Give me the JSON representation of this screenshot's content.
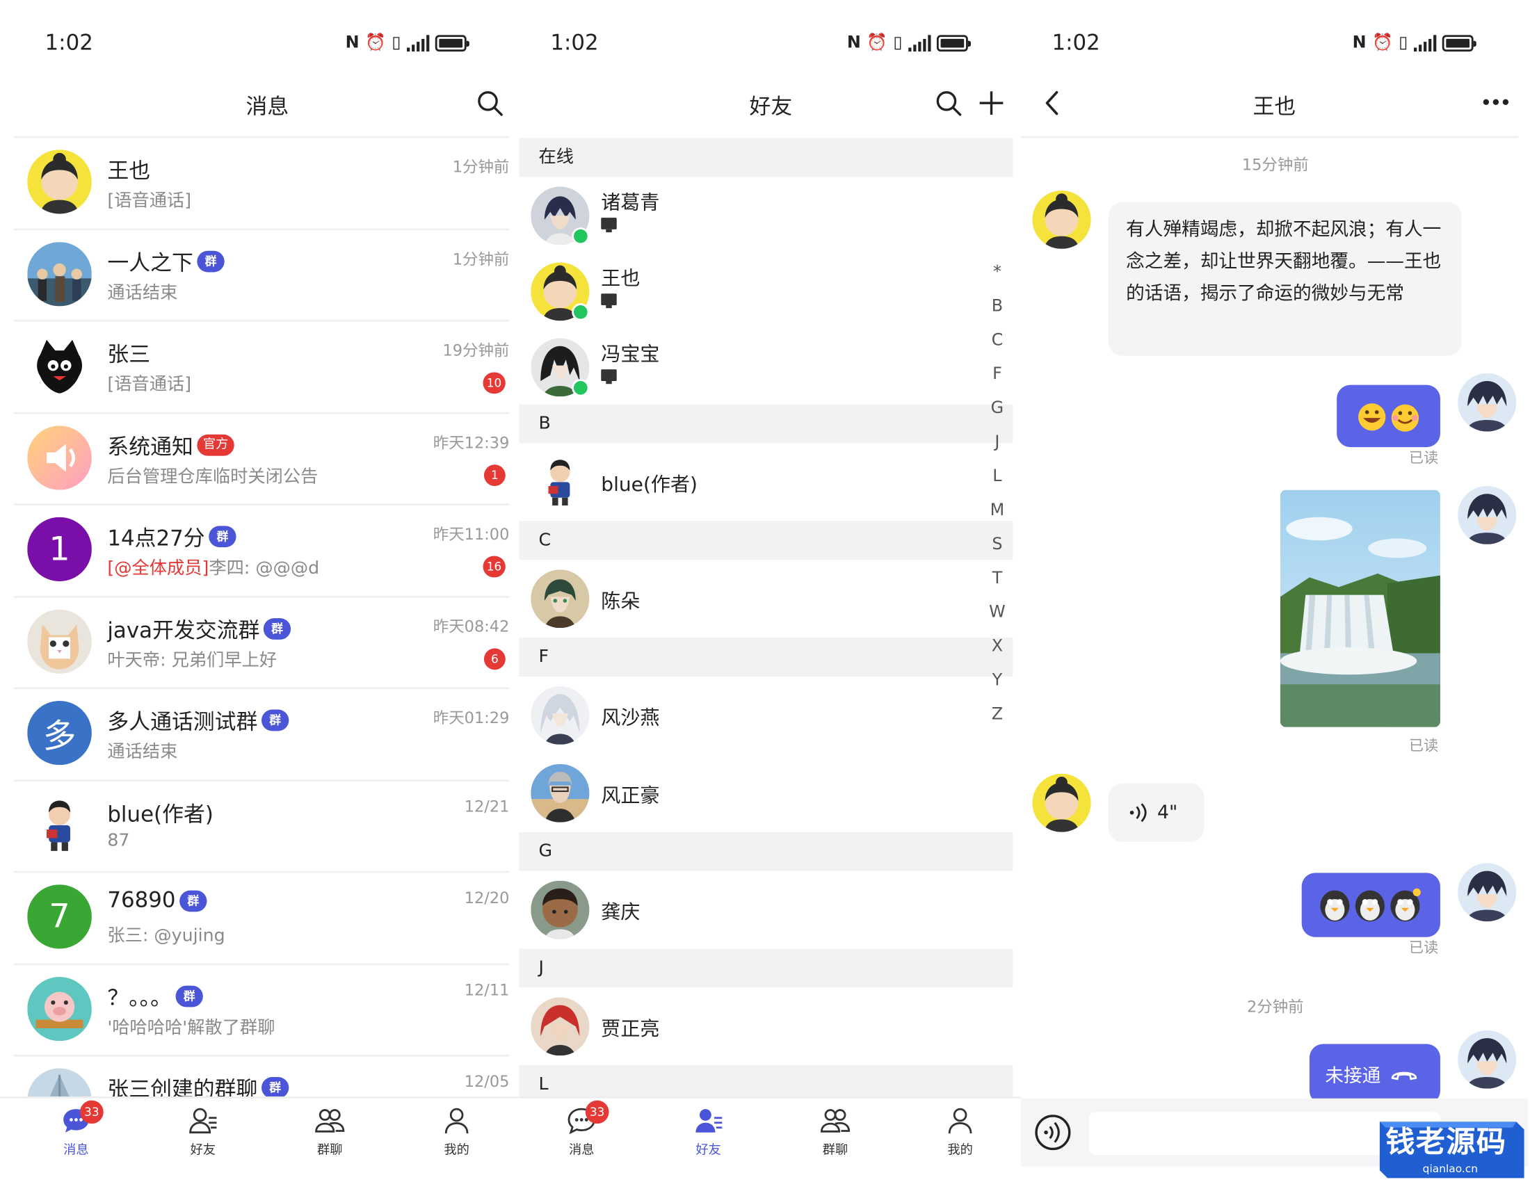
{
  "status": {
    "time": "1:02"
  },
  "messages_screen": {
    "title": "消息",
    "items": [
      {
        "name": "王也",
        "tag": "",
        "sub": "[语音通话]",
        "sub_prefix": "",
        "time": "1分钟前",
        "unread": ""
      },
      {
        "name": "一人之下",
        "tag": "群",
        "sub": "通话结束",
        "sub_prefix": "",
        "time": "1分钟前",
        "unread": ""
      },
      {
        "name": "张三",
        "tag": "",
        "sub": "[语音通话]",
        "sub_prefix": "",
        "time": "19分钟前",
        "unread": "10"
      },
      {
        "name": "系统通知",
        "tag": "官方",
        "sub": "后台管理仓库临时关闭公告",
        "sub_prefix": "",
        "time": "昨天12:39",
        "unread": "1"
      },
      {
        "name": "14点27分",
        "tag": "群",
        "sub": "李四: @@@d",
        "sub_prefix": "[@全体成员]",
        "time": "昨天11:00",
        "unread": "16",
        "avatar_text": "1"
      },
      {
        "name": "java开发交流群",
        "tag": "群",
        "sub": "叶天帝: 兄弟们早上好",
        "sub_prefix": "",
        "time": "昨天08:42",
        "unread": "6"
      },
      {
        "name": "多人通话测试群",
        "tag": "群",
        "sub": "通话结束",
        "sub_prefix": "",
        "time": "昨天01:29",
        "unread": "",
        "avatar_text": "多"
      },
      {
        "name": "blue(作者)",
        "tag": "",
        "sub": "87",
        "sub_prefix": "",
        "time": "12/21",
        "unread": ""
      },
      {
        "name": "76890",
        "tag": "群",
        "sub": "张三: @yujing",
        "sub_prefix": "",
        "time": "12/20",
        "unread": "",
        "avatar_text": "7"
      },
      {
        "name": "？。。。",
        "tag": "群",
        "sub": "'哈哈哈哈'解散了群聊",
        "sub_prefix": "",
        "time": "12/11",
        "unread": ""
      },
      {
        "name": "张三创建的群聊",
        "tag": "群",
        "sub": "",
        "sub_prefix": "",
        "time": "12/05",
        "unread": ""
      }
    ]
  },
  "tabs": [
    {
      "label": "消息",
      "icon": "chat-icon",
      "badge": "33"
    },
    {
      "label": "好友",
      "icon": "friends-icon",
      "badge": ""
    },
    {
      "label": "群聊",
      "icon": "group-icon",
      "badge": ""
    },
    {
      "label": "我的",
      "icon": "profile-icon",
      "badge": ""
    }
  ],
  "friends_screen": {
    "title": "好友",
    "online_header": "在线",
    "online": [
      {
        "name": "诸葛青"
      },
      {
        "name": "王也"
      },
      {
        "name": "冯宝宝"
      }
    ],
    "groups": [
      {
        "letter": "B",
        "friends": [
          "blue(作者)"
        ]
      },
      {
        "letter": "C",
        "friends": [
          "陈朵"
        ]
      },
      {
        "letter": "F",
        "friends": [
          "风沙燕",
          "风正豪"
        ]
      },
      {
        "letter": "G",
        "friends": [
          "龚庆"
        ]
      },
      {
        "letter": "J",
        "friends": [
          "贾正亮"
        ]
      },
      {
        "letter": "L",
        "friends": []
      }
    ],
    "index": [
      "*",
      "B",
      "C",
      "F",
      "G",
      "J",
      "L",
      "M",
      "S",
      "T",
      "W",
      "X",
      "Y",
      "Z"
    ]
  },
  "chat_screen": {
    "title": "王也",
    "time_mark_1": "15分钟前",
    "incoming_text": "有人殚精竭虑，却掀不起风浪；有人一念之差，却让世界天翻地覆。——王也的话语，揭示了命运的微妙与无常",
    "read_label": "已读",
    "voice_duration": "4\"",
    "time_mark_2": "2分钟前",
    "missed_call": "未接通"
  },
  "watermark": {
    "title": "钱老源码",
    "url": "qianlao.cn"
  },
  "colors": {
    "accent": "#5b63e6",
    "badge": "#e53935",
    "tag": "#4a55d8",
    "online": "#22c55e"
  }
}
